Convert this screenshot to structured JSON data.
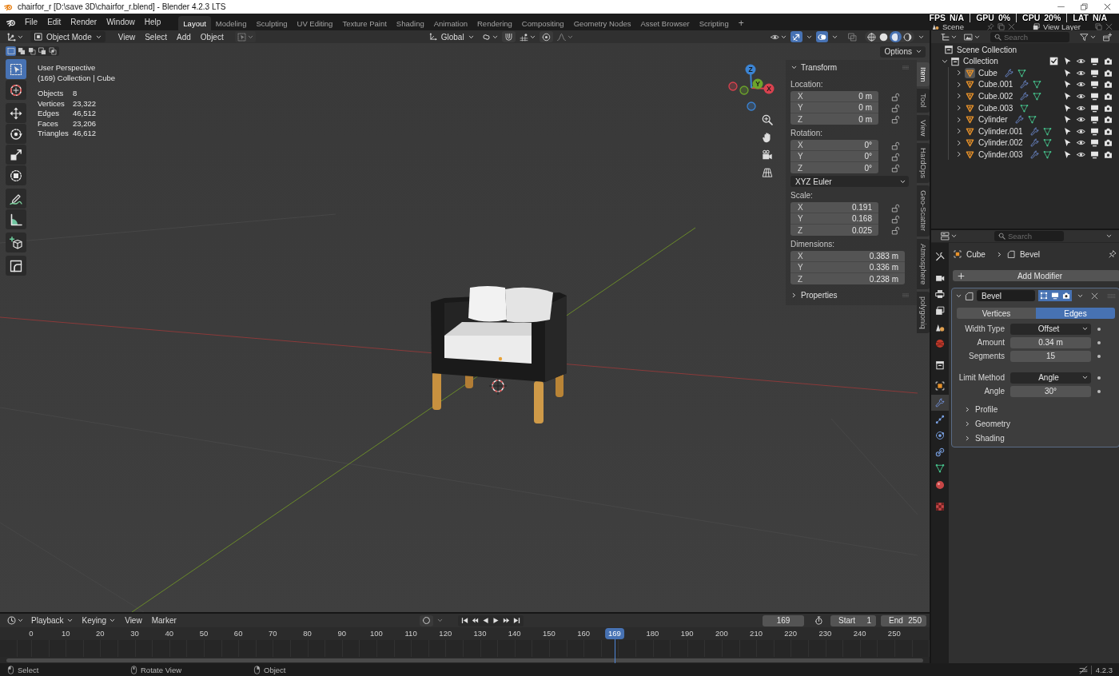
{
  "window": {
    "title": "chairfor_r [D:\\save 3D\\chairfor_r.blend] - Blender 4.2.3 LTS"
  },
  "menu": [
    "File",
    "Edit",
    "Render",
    "Window",
    "Help"
  ],
  "workspaces": [
    {
      "label": "Layout",
      "selected": true
    },
    {
      "label": "Modeling",
      "selected": false
    },
    {
      "label": "Sculpting",
      "selected": false
    },
    {
      "label": "UV Editing",
      "selected": false
    },
    {
      "label": "Texture Paint",
      "selected": false
    },
    {
      "label": "Shading",
      "selected": false
    },
    {
      "label": "Animation",
      "selected": false
    },
    {
      "label": "Rendering",
      "selected": false
    },
    {
      "label": "Compositing",
      "selected": false
    },
    {
      "label": "Geometry Nodes",
      "selected": false
    },
    {
      "label": "Asset Browser",
      "selected": false
    },
    {
      "label": "Scripting",
      "selected": false
    }
  ],
  "add_workspace": "+",
  "scene_selector": {
    "scene": "Scene",
    "view_layer": "View Layer"
  },
  "performance_overlay": [
    {
      "label": "FPS",
      "value": "N/A"
    },
    {
      "label": "GPU",
      "value": "0%"
    },
    {
      "label": "CPU",
      "value": "20%"
    },
    {
      "label": "LAT",
      "value": "N/A"
    }
  ],
  "viewport_header": {
    "mode": "Object Mode",
    "menus": [
      "View",
      "Select",
      "Add",
      "Object"
    ],
    "orientation": "Global",
    "gizmos": true,
    "overlays": true,
    "xray": false,
    "shading": [
      {
        "kind": "wireframe",
        "selected": false
      },
      {
        "kind": "solid",
        "selected": false
      },
      {
        "kind": "material",
        "selected": true
      },
      {
        "kind": "rendered",
        "selected": false
      }
    ]
  },
  "viewport": {
    "options": "Options",
    "select_modes": [
      {
        "kind": "set",
        "selected": true
      },
      {
        "kind": "extend",
        "selected": false
      },
      {
        "kind": "subtract",
        "selected": false
      },
      {
        "kind": "invert",
        "selected": false
      },
      {
        "kind": "intersect",
        "selected": false
      }
    ],
    "tool_groups": [
      [
        {
          "kind": "select_box",
          "selected": true
        },
        {
          "kind": "cursor",
          "selected": false
        }
      ],
      [
        {
          "kind": "move",
          "selected": false
        },
        {
          "kind": "rotate",
          "selected": false
        },
        {
          "kind": "scale",
          "selected": false
        },
        {
          "kind": "transform",
          "selected": false
        }
      ],
      [
        {
          "kind": "annotate",
          "selected": false
        },
        {
          "kind": "measure",
          "selected": false
        }
      ],
      [
        {
          "kind": "add_cube",
          "selected": false
        }
      ],
      [
        {
          "kind": "corner",
          "selected": false
        }
      ]
    ],
    "view_name": "User Perspective",
    "context": "(169) Collection | Cube",
    "stats": [
      {
        "label": "Objects",
        "value": "8"
      },
      {
        "label": "Vertices",
        "value": "23,322"
      },
      {
        "label": "Edges",
        "value": "46,512"
      },
      {
        "label": "Faces",
        "value": "23,206"
      },
      {
        "label": "Triangles",
        "value": "46,612"
      }
    ],
    "gizmo_axes": [
      {
        "kind": "x",
        "label": "X",
        "color": "#d9424f"
      },
      {
        "kind": "y",
        "label": "Y",
        "color": "#6da52b"
      },
      {
        "kind": "z",
        "label": "Z",
        "color": "#3b84d4"
      }
    ]
  },
  "sidebar": {
    "tabs": [
      {
        "label": "Item",
        "selected": true
      },
      {
        "label": "Tool",
        "selected": false
      },
      {
        "label": "View",
        "selected": false
      },
      {
        "label": "HardOps",
        "selected": false
      },
      {
        "label": "Geo-Scatter",
        "selected": false
      },
      {
        "label": "Atmosphere",
        "selected": false
      },
      {
        "label": "polygoniq",
        "selected": false
      }
    ],
    "panels": [
      {
        "title": "Transform",
        "expanded": true,
        "sections": [
          {
            "kind": "vector",
            "label": "Location:",
            "fields": [
              {
                "axis": "X",
                "value": "0 m",
                "locked": false
              },
              {
                "axis": "Y",
                "value": "0 m",
                "locked": false
              },
              {
                "axis": "Z",
                "value": "0 m",
                "locked": false
              }
            ]
          },
          {
            "kind": "vector",
            "label": "Rotation:",
            "fields": [
              {
                "axis": "X",
                "value": "0°",
                "locked": false
              },
              {
                "axis": "Y",
                "value": "0°",
                "locked": false
              },
              {
                "axis": "Z",
                "value": "0°",
                "locked": false
              }
            ]
          },
          {
            "kind": "dropdown",
            "value": "XYZ Euler"
          },
          {
            "kind": "vector",
            "label": "Scale:",
            "fields": [
              {
                "axis": "X",
                "value": "0.191",
                "locked": false
              },
              {
                "axis": "Y",
                "value": "0.168",
                "locked": false
              },
              {
                "axis": "Z",
                "value": "0.025",
                "locked": false
              }
            ]
          },
          {
            "kind": "vector",
            "label": "Dimensions:",
            "fields": [
              {
                "axis": "X",
                "value": "0.383 m"
              },
              {
                "axis": "Y",
                "value": "0.336 m"
              },
              {
                "axis": "Z",
                "value": "0.238 m"
              }
            ]
          }
        ]
      },
      {
        "title": "Properties",
        "expanded": false
      }
    ]
  },
  "outliner": {
    "search": {
      "placeholder": "Search"
    },
    "scene_collection": "Scene Collection",
    "collections": [
      {
        "name": "Collection",
        "expanded": true,
        "checked": true,
        "children": [
          {
            "name": "Cube",
            "active": true,
            "expanded": false,
            "has_modifier": true
          },
          {
            "name": "Cube.001",
            "active": false,
            "expanded": false,
            "has_modifier": true
          },
          {
            "name": "Cube.002",
            "active": false,
            "expanded": false,
            "has_modifier": true
          },
          {
            "name": "Cube.003",
            "active": false,
            "expanded": false,
            "has_modifier": false
          },
          {
            "name": "Cylinder",
            "active": false,
            "expanded": false,
            "has_modifier": true
          },
          {
            "name": "Cylinder.001",
            "active": false,
            "expanded": false,
            "has_modifier": true
          },
          {
            "name": "Cylinder.002",
            "active": false,
            "expanded": false,
            "has_modifier": true
          },
          {
            "name": "Cylinder.003",
            "active": false,
            "expanded": false,
            "has_modifier": true
          }
        ]
      }
    ]
  },
  "properties": {
    "search": {
      "placeholder": "Search"
    },
    "tab_groups": [
      [
        {
          "kind": "tool",
          "selected": false
        }
      ],
      [
        {
          "kind": "render",
          "selected": false
        },
        {
          "kind": "output",
          "selected": false
        },
        {
          "kind": "view_layer",
          "selected": false
        },
        {
          "kind": "scene",
          "selected": false
        },
        {
          "kind": "world",
          "selected": false
        }
      ],
      [
        {
          "kind": "collection",
          "selected": false
        }
      ],
      [
        {
          "kind": "object",
          "selected": false
        },
        {
          "kind": "modifiers",
          "selected": true
        },
        {
          "kind": "particles",
          "selected": false
        },
        {
          "kind": "physics",
          "selected": false
        },
        {
          "kind": "constraints",
          "selected": false
        },
        {
          "kind": "data",
          "selected": false
        },
        {
          "kind": "material",
          "selected": false
        }
      ],
      [
        {
          "kind": "texture",
          "selected": false
        }
      ]
    ],
    "breadcrumb": [
      "Cube",
      "Bevel"
    ],
    "add_modifier": "Add Modifier",
    "modifiers": [
      {
        "name": "Bevel",
        "expanded": true,
        "edit_mode": true,
        "viewport": true,
        "render": true,
        "affect": [
          {
            "label": "Vertices",
            "selected": false
          },
          {
            "label": "Edges",
            "selected": true
          }
        ],
        "field_groups": [
          [
            {
              "kind": "dropdown",
              "label": "Width Type",
              "value": "Offset"
            },
            {
              "kind": "number",
              "label": "Amount",
              "value": "0.34 m"
            },
            {
              "kind": "number",
              "label": "Segments",
              "value": "15"
            }
          ],
          [
            {
              "kind": "dropdown",
              "label": "Limit Method",
              "value": "Angle"
            },
            {
              "kind": "number",
              "label": "Angle",
              "value": "30°"
            }
          ]
        ],
        "subpanels": [
          {
            "label": "Profile",
            "expanded": false
          },
          {
            "label": "Geometry",
            "expanded": false
          },
          {
            "label": "Shading",
            "expanded": false
          }
        ]
      }
    ]
  },
  "timeline": {
    "menus": [
      {
        "label": "Playback",
        "dropdown": true
      },
      {
        "label": "Keying",
        "dropdown": true
      },
      {
        "label": "View",
        "dropdown": false
      },
      {
        "label": "Marker",
        "dropdown": false
      }
    ],
    "auto_keying": false,
    "current_frame": "169",
    "start_label": "Start",
    "start": "1",
    "end_label": "End",
    "end": "250",
    "ticks": [
      "0",
      "10",
      "20",
      "30",
      "40",
      "50",
      "60",
      "70",
      "80",
      "90",
      "100",
      "110",
      "120",
      "130",
      "140",
      "150",
      "160",
      "180",
      "190",
      "200",
      "210",
      "220",
      "230",
      "240",
      "250"
    ],
    "playhead": {
      "label": "169",
      "level": 0.65
    }
  },
  "status_bar": {
    "hints": [
      {
        "kind": "left",
        "label": "Select"
      },
      {
        "kind": "middle",
        "label": "Rotate View"
      },
      {
        "kind": "right",
        "label": "Object"
      }
    ],
    "version": "4.2.3"
  }
}
